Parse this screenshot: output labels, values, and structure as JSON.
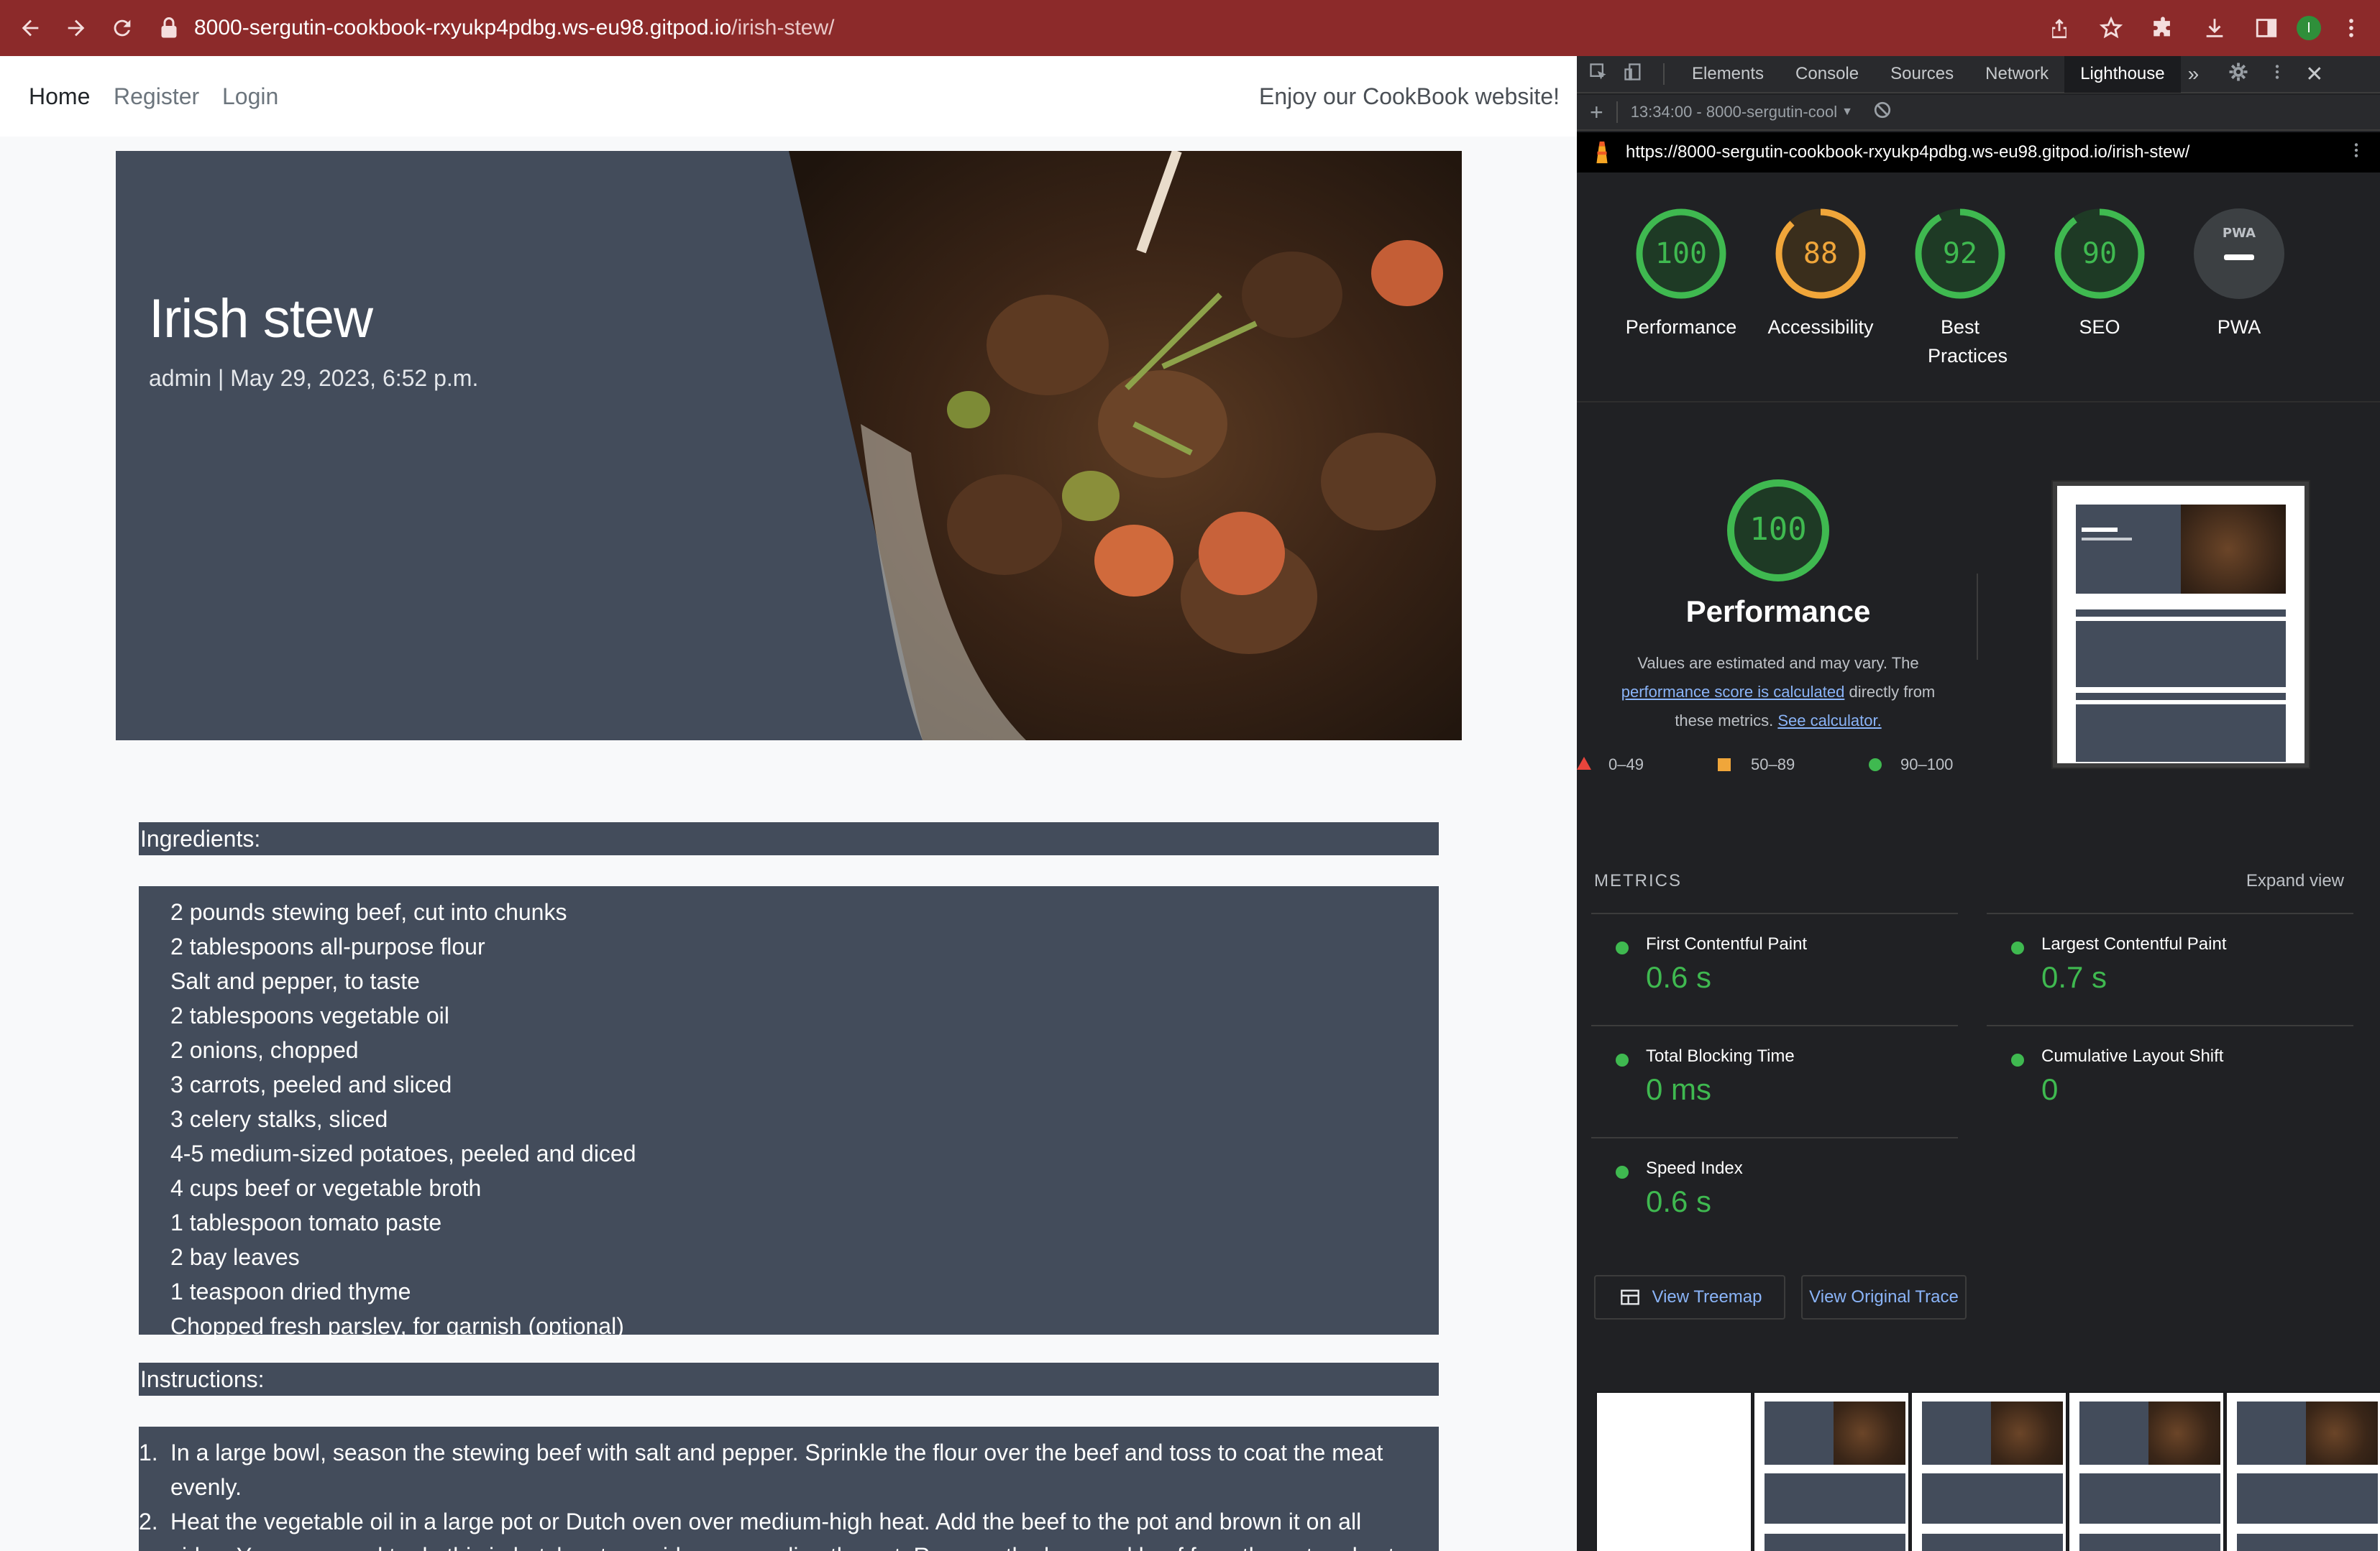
{
  "browser": {
    "url_host": "8000-sergutin-cookbook-rxyukp4pdbg.ws-eu98.gitpod.io",
    "url_path": "/irish-stew/",
    "profile_initial": "I"
  },
  "site": {
    "nav": {
      "home": "Home",
      "register": "Register",
      "login": "Login",
      "tagline": "Enjoy our CookBook website!"
    },
    "recipe": {
      "title": "Irish stew",
      "meta": "admin | May 29, 2023, 6:52 p.m.",
      "ingredients_heading": "Ingredients:",
      "ingredients": [
        "2 pounds stewing beef, cut into chunks",
        "2 tablespoons all-purpose flour",
        "Salt and pepper, to taste",
        "2 tablespoons vegetable oil",
        "2 onions, chopped",
        "3 carrots, peeled and sliced",
        "3 celery stalks, sliced",
        "4-5 medium-sized potatoes, peeled and diced",
        "4 cups beef or vegetable broth",
        "1 tablespoon tomato paste",
        "2 bay leaves",
        "1 teaspoon dried thyme",
        "Chopped fresh parsley, for garnish (optional)"
      ],
      "instructions_heading": "Instructions:",
      "instructions": [
        {
          "num": "1.",
          "line1": "In a large bowl, season the stewing beef with salt and pepper. Sprinkle the flour over the beef and toss to coat the meat",
          "line2": "evenly."
        },
        {
          "num": "2.",
          "line1": "Heat the vegetable oil in a large pot or Dutch oven over medium-high heat. Add the beef to the pot and brown it on all",
          "line2": "sides. You may need to do this in batches to avoid overcrowding the pot. Remove the browned beef from the pot and set"
        }
      ]
    }
  },
  "devtools": {
    "tabs": [
      "Elements",
      "Console",
      "Sources",
      "Network",
      "Lighthouse"
    ],
    "active_tab": "Lighthouse",
    "report_select": "13:34:00 - 8000-sergutin-cool",
    "report_url": "https://8000-sergutin-cookbook-rxyukp4pdbg.ws-eu98.gitpod.io/irish-stew/",
    "scores": [
      {
        "label": "Performance",
        "value": "100",
        "fraction": 1.0,
        "color": "#3fb950"
      },
      {
        "label": "Accessibility",
        "value": "88",
        "fraction": 0.88,
        "color": "#f0a63a"
      },
      {
        "label": "Best Practices",
        "value": "92",
        "fraction": 0.92,
        "color": "#3fb950"
      },
      {
        "label": "SEO",
        "value": "90",
        "fraction": 0.9,
        "color": "#3fb950"
      },
      {
        "label": "PWA",
        "value": "PWA",
        "fraction": 0,
        "color": "#9aa0a6"
      }
    ],
    "perf_detail": {
      "score": "100",
      "title": "Performance",
      "desc_1": "Values are estimated and may vary. The",
      "desc_link": "performance score is calculated",
      "desc_2": "directly from",
      "desc_3": "these metrics.",
      "calc_link": "See calculator.",
      "legend": [
        "0–49",
        "50–89",
        "90–100"
      ]
    },
    "metrics_heading": "METRICS",
    "expand_view": "Expand view",
    "metrics": [
      {
        "name": "First Contentful Paint",
        "value": "0.6 s"
      },
      {
        "name": "Largest Contentful Paint",
        "value": "0.7 s"
      },
      {
        "name": "Total Blocking Time",
        "value": "0 ms"
      },
      {
        "name": "Cumulative Layout Shift",
        "value": "0"
      },
      {
        "name": "Speed Index",
        "value": "0.6 s"
      }
    ],
    "buttons": {
      "treemap": "View Treemap",
      "trace": "View Original Trace"
    }
  },
  "colors": {
    "chrome": "#8c2a2a",
    "hero": "#434c5b",
    "good": "#3fb950",
    "average": "#f0a63a",
    "poor": "#e8453c"
  }
}
